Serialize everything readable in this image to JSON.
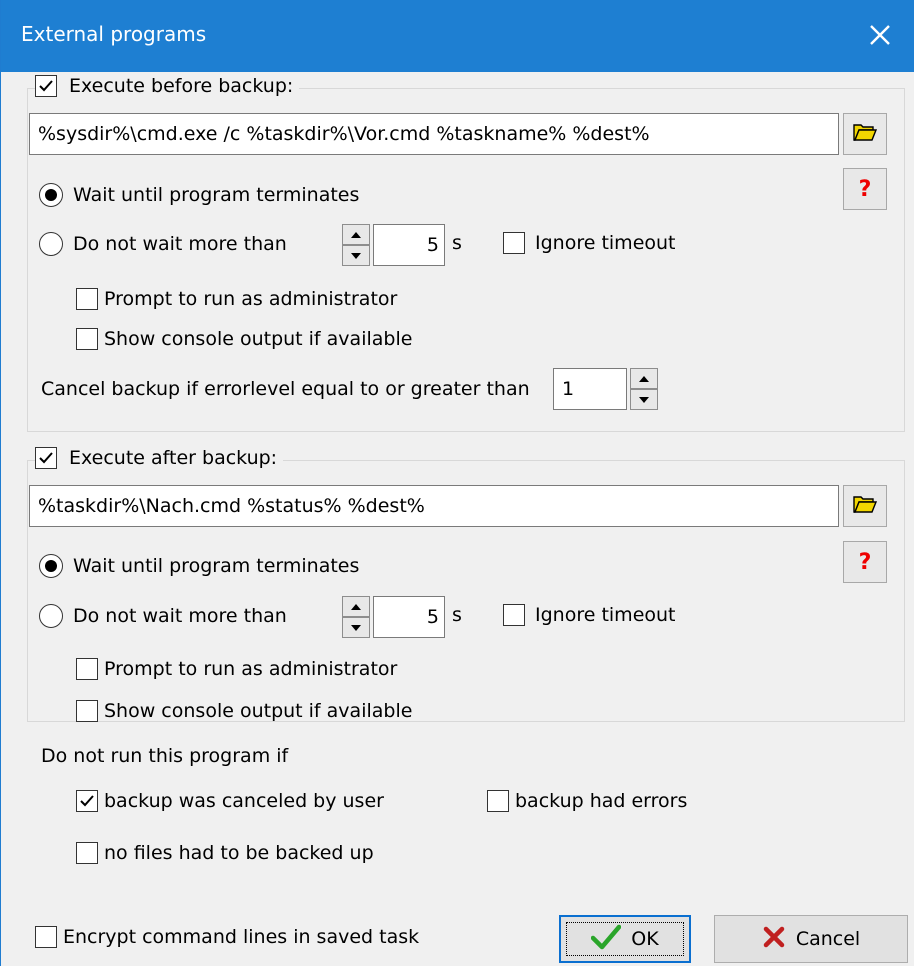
{
  "window": {
    "title": "External programs"
  },
  "before": {
    "legend": "Execute before backup:",
    "command": "%sysdir%\\cmd.exe /c %taskdir%\\Vor.cmd %taskname% %dest%",
    "wait_until": "Wait until program terminates",
    "do_not_wait": "Do not wait more than",
    "seconds": "5",
    "seconds_unit": "s",
    "ignore_timeout": "Ignore timeout",
    "prompt_admin": "Prompt to run as administrator",
    "show_console": "Show console output if available",
    "cancel_label": "Cancel backup if errorlevel equal to or greater than",
    "errorlevel": "1"
  },
  "after": {
    "legend": "Execute after backup:",
    "command": "%taskdir%\\Nach.cmd %status% %dest%",
    "wait_until": "Wait until program terminates",
    "do_not_wait": "Do not wait more than",
    "seconds": "5",
    "seconds_unit": "s",
    "ignore_timeout": "Ignore timeout",
    "prompt_admin": "Prompt to run as administrator",
    "show_console": "Show console output if available",
    "do_not_run_label": "Do not run this program if",
    "canceled_by_user": "backup was canceled by user",
    "had_errors": "backup had errors",
    "no_files": "no files had to be backed up"
  },
  "footer": {
    "encrypt": "Encrypt command lines in saved task",
    "ok": "OK",
    "cancel": "Cancel"
  },
  "colors": {
    "titlebar": "#1e7fd2",
    "help": "#e00000",
    "ok_check": "#2aa52a",
    "cancel_x": "#c02020",
    "folder": "#f2d600"
  },
  "icons": {
    "close": "close-icon",
    "folder": "folder-open-icon",
    "help": "help-icon",
    "check": "checkmark-icon",
    "x": "cancel-x-icon"
  }
}
